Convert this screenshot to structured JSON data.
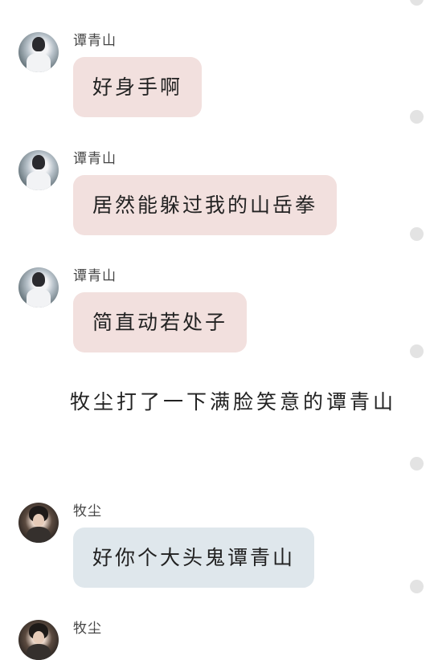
{
  "messages": [
    {
      "sender": "谭青山",
      "text": "好身手啊",
      "avatar": "avatar-tan-qingshan",
      "bubble_color": "#f2e0de"
    },
    {
      "sender": "谭青山",
      "text": "居然能躲过我的山岳拳",
      "avatar": "avatar-tan-qingshan",
      "bubble_color": "#f2e0de"
    },
    {
      "sender": "谭青山",
      "text": "简直动若处子",
      "avatar": "avatar-tan-qingshan",
      "bubble_color": "#f2e0de"
    },
    {
      "sender": "牧尘",
      "text": "好你个大头鬼谭青山",
      "avatar": "avatar-mu-chen",
      "bubble_color": "#dfe7ec"
    },
    {
      "sender": "牧尘",
      "text": "",
      "avatar": "avatar-mu-chen"
    }
  ],
  "narration": "牧尘打了一下满脸笑意的谭青山",
  "colors": {
    "pink_bubble": "#f2e0de",
    "blue_bubble": "#dfe7ec",
    "dot": "#e3e3e3"
  }
}
